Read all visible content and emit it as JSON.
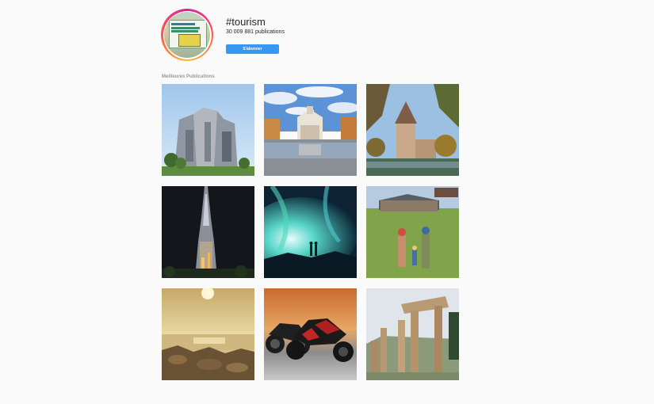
{
  "hashtag": {
    "title": "#tourism",
    "post_count": "30 009 881 publications",
    "follow_label": "S'abonner",
    "avatar_sign_label": "Indonesia"
  },
  "top_posts": {
    "section_label": "Meilleures Publications",
    "posts": [
      {
        "subject": "modern-building"
      },
      {
        "subject": "cathedral-square"
      },
      {
        "subject": "castle-tower"
      },
      {
        "subject": "skyscraper-night"
      },
      {
        "subject": "aurora"
      },
      {
        "subject": "hikers-field"
      },
      {
        "subject": "sunset-beach"
      },
      {
        "subject": "motorcycles"
      },
      {
        "subject": "ancient-columns"
      }
    ]
  },
  "colors": {
    "follow_button": "#3897f0",
    "avatar_ring": "#d6249f"
  }
}
